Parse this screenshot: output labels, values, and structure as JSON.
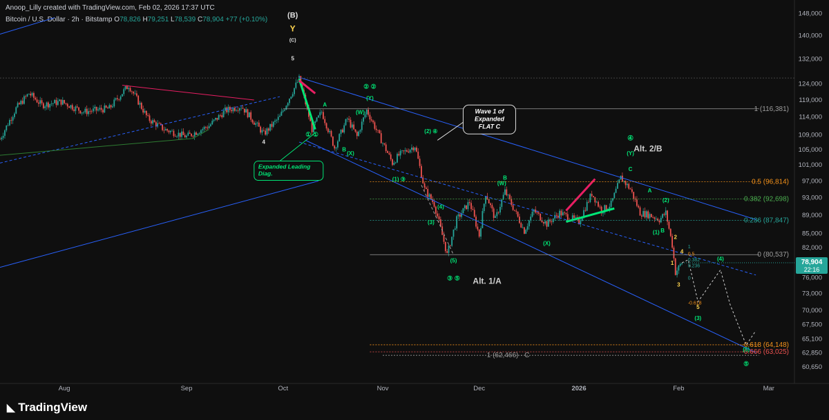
{
  "header": {
    "credit": "Anoop_Lilly created with TradingView.com, Feb 02, 2026 17:37 UTC",
    "symbol": "Bitcoin / U.S. Dollar · 2h · Bitstamp",
    "o_label": "O",
    "o": "78,826",
    "h_label": "H",
    "h": "79,251",
    "l_label": "L",
    "l": "78,539",
    "c_label": "C",
    "c": "78,904",
    "change": "+77 (+0.10%)"
  },
  "brand": "TradingView",
  "colors": {
    "background": "#0f0f0f",
    "up": "#26a69a",
    "down": "#ef5350",
    "channel": "#2962ff",
    "wave_green": "#00e676",
    "wave_yellow": "#ffd54f",
    "fib_orange": "#f7931a",
    "fib_green": "#26a69a",
    "fib_red": "#ef5350",
    "pink": "#e91e63"
  },
  "chart_data": {
    "type": "candlestick",
    "symbol": "BTCUSD",
    "timeframe": "2h",
    "ylim": [
      59000,
      150000
    ],
    "y_ticks": [
      "148,000",
      "140,000",
      "132,000",
      "124,000",
      "119,000",
      "114,000",
      "109,000",
      "105,000",
      "101,000",
      "97,000",
      "93,000",
      "89,000",
      "85,000",
      "82,000",
      "79,000",
      "76,000",
      "73,000",
      "70,000",
      "67,500",
      "65,100",
      "62,850",
      "60,650"
    ],
    "x_ticks": [
      "Aug",
      "Sep",
      "Oct",
      "Nov",
      "Dec",
      "2026",
      "Feb",
      "Mar"
    ],
    "x_range": [
      "2025-07-05",
      "2026-03-09"
    ],
    "last_price": {
      "value": "78,904",
      "countdown": "22:16"
    },
    "price_path": [
      [
        "2025-07-05",
        107800
      ],
      [
        "2025-07-10",
        116500
      ],
      [
        "2025-07-14",
        121000
      ],
      [
        "2025-07-18",
        117500
      ],
      [
        "2025-07-24",
        118500
      ],
      [
        "2025-07-31",
        115500
      ],
      [
        "2025-08-08",
        116500
      ],
      [
        "2025-08-14",
        123500
      ],
      [
        "2025-08-20",
        113500
      ],
      [
        "2025-08-25",
        110500
      ],
      [
        "2025-09-01",
        108500
      ],
      [
        "2025-09-08",
        111500
      ],
      [
        "2025-09-13",
        115800
      ],
      [
        "2025-09-18",
        117200
      ],
      [
        "2025-09-25",
        109200
      ],
      [
        "2025-09-30",
        114000
      ],
      [
        "2025-10-06",
        125500
      ],
      [
        "2025-10-10",
        110500
      ],
      [
        "2025-10-13",
        115500
      ],
      [
        "2025-10-17",
        105500
      ],
      [
        "2025-10-21",
        113500
      ],
      [
        "2025-10-24",
        108500
      ],
      [
        "2025-10-27",
        116000
      ],
      [
        "2025-10-31",
        108500
      ],
      [
        "2025-11-04",
        101500
      ],
      [
        "2025-11-06",
        103500
      ],
      [
        "2025-11-11",
        106000
      ],
      [
        "2025-11-14",
        95000
      ],
      [
        "2025-11-17",
        91500
      ],
      [
        "2025-11-21",
        80500
      ],
      [
        "2025-11-24",
        88000
      ],
      [
        "2025-11-28",
        92000
      ],
      [
        "2025-12-01",
        84500
      ],
      [
        "2025-12-03",
        94000
      ],
      [
        "2025-12-06",
        88000
      ],
      [
        "2025-12-09",
        94500
      ],
      [
        "2025-12-15",
        85500
      ],
      [
        "2025-12-18",
        90000
      ],
      [
        "2025-12-22",
        87000
      ],
      [
        "2025-12-26",
        89500
      ],
      [
        "2026-01-01",
        87500
      ],
      [
        "2026-01-05",
        94000
      ],
      [
        "2026-01-08",
        90000
      ],
      [
        "2026-01-11",
        91500
      ],
      [
        "2026-01-14",
        97800
      ],
      [
        "2026-01-17",
        95000
      ],
      [
        "2026-01-20",
        89500
      ],
      [
        "2026-01-23",
        89000
      ],
      [
        "2026-01-26",
        88000
      ],
      [
        "2026-01-28",
        89500
      ],
      [
        "2026-01-30",
        82500
      ],
      [
        "2026-01-31",
        77000
      ],
      [
        "2026-02-02",
        78904
      ]
    ],
    "projection": [
      [
        "2026-02-02",
        78904
      ],
      [
        "2026-02-04",
        79500
      ],
      [
        "2026-02-07",
        71500
      ],
      [
        "2026-02-14",
        77500
      ],
      [
        "2026-02-17",
        71000
      ],
      [
        "2026-02-22",
        64100
      ],
      [
        "2026-02-25",
        66500
      ]
    ],
    "horizontal_levels": [
      {
        "label": "1 (116,381)",
        "price": 116381,
        "color": "#9e9e9e"
      },
      {
        "label": "0.5 (96,814)",
        "price": 96814,
        "color": "#f7931a"
      },
      {
        "label": "0.382 (92,698)",
        "price": 92698,
        "color": "#4caf50"
      },
      {
        "label": "0.236 (87,847)",
        "price": 87847,
        "color": "#26a69a"
      },
      {
        "label": "0 (80,537)",
        "price": 80537,
        "color": "#9e9e9e"
      },
      {
        "label": "-0.618 (64,148)",
        "price": 64148,
        "color": "#f7931a"
      },
      {
        "label": "-0.666 (63,025)",
        "price": 63025,
        "color": "#ef5350"
      },
      {
        "label": "1 (62,466) · C",
        "price": 62466,
        "color": "#9e9e9e"
      }
    ],
    "mini_fib": [
      "0.5",
      "0.382",
      "0.236",
      "0",
      "-0.618",
      "1"
    ],
    "annotations": [
      {
        "text": "Wave 1 of Expanded FLAT C"
      },
      {
        "text": "Expanded Leading Diag."
      },
      {
        "text": "Alt. 2/B"
      },
      {
        "text": "Alt. 1/A"
      }
    ],
    "wave_labels": [
      "(B)",
      "Y",
      "(C)",
      "5",
      "4",
      "①",
      "②",
      "③",
      "④",
      "⑤",
      "(1)",
      "(2)",
      "(3)",
      "(4)",
      "(5)",
      "(W)",
      "(X)",
      "(Y)",
      "A",
      "B",
      "C",
      "1",
      "2",
      "3",
      "4",
      "5"
    ]
  }
}
